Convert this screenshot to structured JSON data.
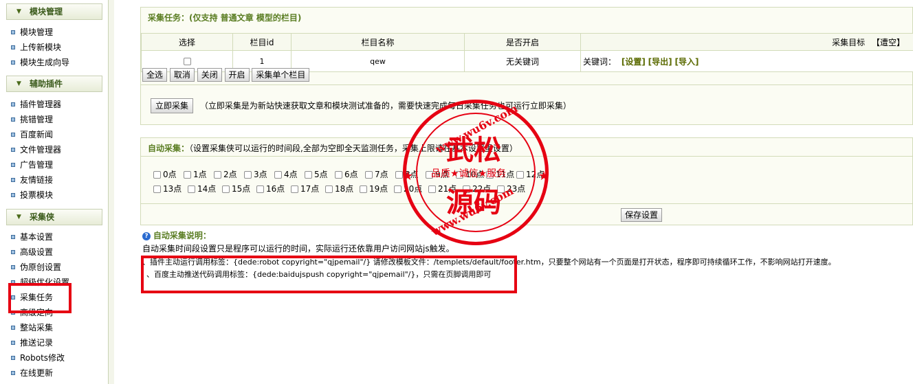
{
  "sidebar": {
    "sections": [
      {
        "title": "模块管理",
        "items": [
          "模块管理",
          "上传新模块",
          "模块生成向导"
        ]
      },
      {
        "title": "辅助插件",
        "items": [
          "插件管理器",
          "挑错管理",
          "百度新闻",
          "文件管理器",
          "广告管理",
          "友情链接",
          "投票模块"
        ]
      },
      {
        "title": "采集侠",
        "items": [
          "基本设置",
          "高级设置",
          "伪原创设置",
          "超级优化设置",
          "采集任务",
          "高级定向",
          "整站采集",
          "推送记录",
          "Robots修改",
          "在线更新"
        ]
      }
    ]
  },
  "task_panel": {
    "title": "采集任务：",
    "title_note": "(仅支持 普通文章 模型的栏目)",
    "columns": [
      "选择",
      "栏目id",
      "栏目名称",
      "是否开启",
      "采集目标"
    ],
    "clear_label": "【遭空】",
    "row": {
      "id": "1",
      "name": "qew",
      "status": "无关键词",
      "keyword_label": "关键词：",
      "link_set": "[设置]",
      "link_export": "[导出]",
      "link_import": "[导入]"
    },
    "buttons": [
      "全选",
      "取消",
      "关闭",
      "开启",
      "采集单个栏目"
    ],
    "collect_now": "立即采集",
    "collect_note": "（立即采集是为新站快速获取文章和模块测试准备的，需要快速完成每日采集任务也可运行立即采集）"
  },
  "auto_panel": {
    "title": "自动采集：",
    "title_note": "（设置采集侠可以运行的时间段,全部为空即全天监测任务，采集上限请在基本设置里设置）",
    "hours_row1": [
      "0点",
      "1点",
      "2点",
      "3点",
      "4点",
      "5点",
      "6点",
      "7点",
      "8点",
      "9点",
      "10点",
      "11点",
      "12点"
    ],
    "hours_row2": [
      "13点",
      "14点",
      "15点",
      "16点",
      "17点",
      "18点",
      "19点",
      "20点",
      "21点",
      "22点",
      "23点"
    ],
    "save": "保存设置",
    "help_title": "自动采集说明：",
    "help_line1": "自动采集时间段设置只是程序可以运行的时间，实际运行还依靠用户访问网站js触发。",
    "help_line2": "、插件主动运行调用标签：{dede:robot copyright=\"qjpemail\"/} 请修改模板文件：/templets/default/footer.htm，只要整个网站有一个页面是打开状态，程序即可持续循环工作，不影响网站打开速度。",
    "help_line3": "、百度主动推送代码调用标签：{dede:baidujspush copyright=\"qjpemail\"/}，只需在页脚调用即可"
  },
  "watermark": {
    "top_arc": "www.wu6v.com",
    "bottom_arc": "www.wu6v.com",
    "line1": "武松",
    "line2": "品质★诚信★服务",
    "line3": "源码",
    "color": "#e60012"
  },
  "colors": {
    "accent": "#5a7d22",
    "highlight": "#e60012",
    "panel_bg": "#fbfcf3"
  }
}
